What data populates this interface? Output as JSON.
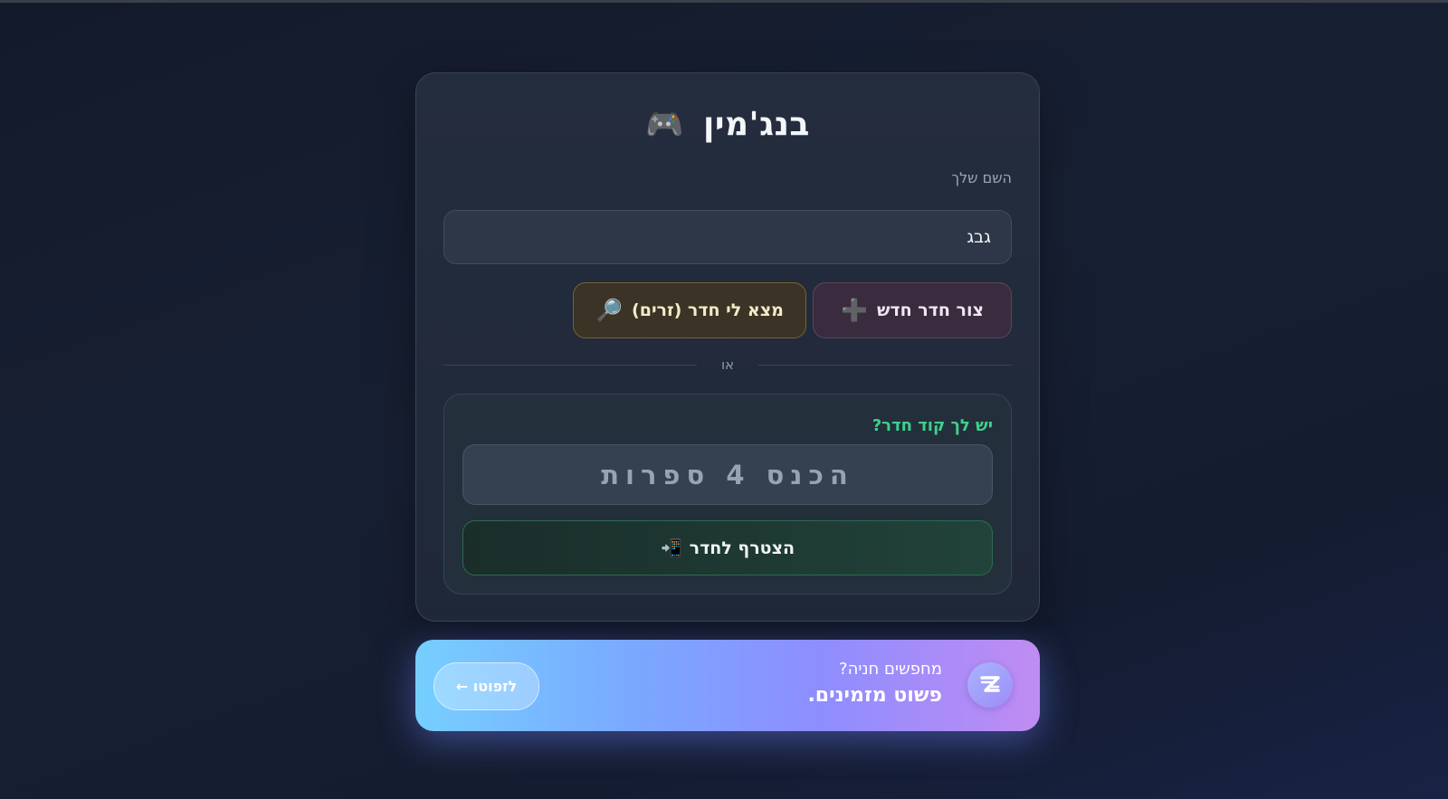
{
  "header": {
    "title": "בנג'מין",
    "title_icon": "🎮"
  },
  "name": {
    "label": "השם שלך",
    "value": "גבג"
  },
  "actions": {
    "create_label": "צור חדר חדש",
    "create_icon": "➕",
    "find_label": "מצא לי חדר (זרים)",
    "find_icon": "🔎"
  },
  "divider": {
    "or_text": "או"
  },
  "room_code": {
    "label": "יש לך קוד חדר?",
    "placeholder": "הכנס 4 ספרות",
    "join_label": "הצטרף לחדר",
    "join_icon": "📲"
  },
  "promo": {
    "question": "מחפשים חניה?",
    "tagline": "פשוט מזמינים.",
    "button_label": "לזפוטו ←"
  },
  "colors": {
    "accent_green": "#3fd08d",
    "background": "#131a2b",
    "card": "#242d3e"
  }
}
